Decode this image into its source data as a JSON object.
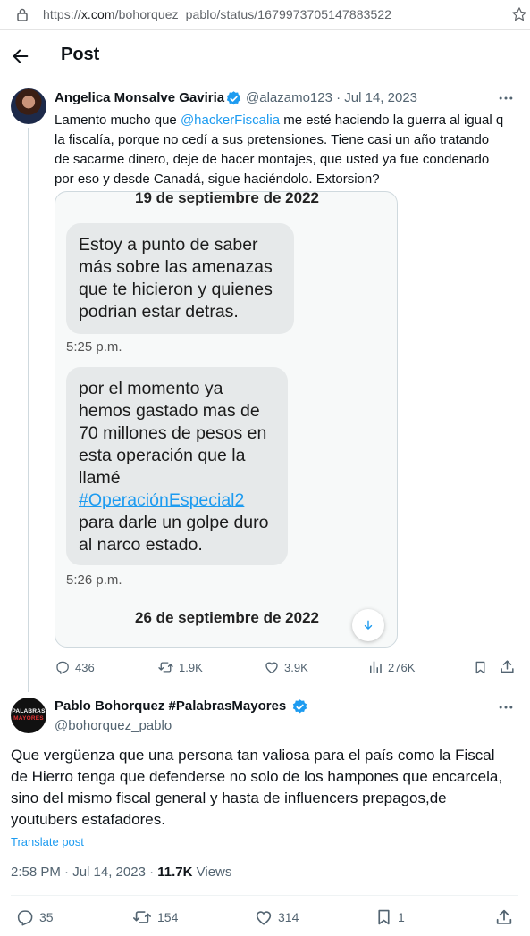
{
  "browser": {
    "url_prefix": "https://",
    "url_host": "x.com",
    "url_path": "/bohorquez_pablo/status/1679973705147883522"
  },
  "header": {
    "title": "Post"
  },
  "tweet1": {
    "name": "Angelica Monsalve Gaviria",
    "handle_date": "@alazamo123 · Jul 14, 2023",
    "text_before": "Lamento mucho que ",
    "mention": "@hackerFiscalia",
    "text_after": " me esté haciendo la guerra al igual q\nla fiscalía, porque no cedí a sus pretensiones. Tiene casi un año tratando\nde sacarme dinero, deje de hacer montajes, que usted ya fue condenado\npor eso y desde Canadá, sigue haciéndolo. Extorsion?",
    "media": {
      "date_top": "19 de septiembre de 2022",
      "bubble1": "Estoy a punto de saber\nmás sobre las amenazas\nque te hicieron y quienes\npodrian estar detras.",
      "time1": "5:25 p.m.",
      "bubble2_before": "por el momento ya\nhemos gastado mas de\n70 millones de pesos en\nesta operación que la\nllamé\n",
      "bubble2_hashtag": "#OperaciónEspecial2",
      "bubble2_after": "\npara darle un golpe duro\nal narco estado.",
      "time2": "5:26 p.m.",
      "date_bottom": "26 de septiembre de 2022"
    },
    "stats": {
      "replies": "436",
      "reposts": "1.9K",
      "likes": "3.9K",
      "views": "276K"
    }
  },
  "tweet2": {
    "name": "Pablo Bohorquez #PalabrasMayores",
    "handle": "@bohorquez_pablo",
    "avatar_text": [
      "PALABRAS",
      "MAYORES"
    ],
    "text": "Que vergüenza que una persona tan valiosa para el país como la Fiscal\nde Hierro tenga que defenderse no solo de los hampones que encarcela,\nsino del mismo fiscal general y hasta de influencers prepagos,de\nyoutubers estafadores.",
    "translate": "Translate post",
    "time_date": "2:58 PM · Jul 14, 2023 · ",
    "views_count": "11.7K",
    "views_label": " Views",
    "stats": {
      "replies": "35",
      "reposts": "154",
      "likes": "314",
      "bookmarks": "1"
    }
  },
  "colors": {
    "accent": "#1d9bf0",
    "muted": "#536471",
    "text": "#0f1419"
  },
  "icons": [
    "lock-icon",
    "star-icon",
    "back-arrow-icon",
    "verified-badge-icon",
    "more-icon",
    "reply-icon",
    "repost-icon",
    "like-icon",
    "views-icon",
    "bookmark-icon",
    "share-icon",
    "arrow-down-icon"
  ]
}
